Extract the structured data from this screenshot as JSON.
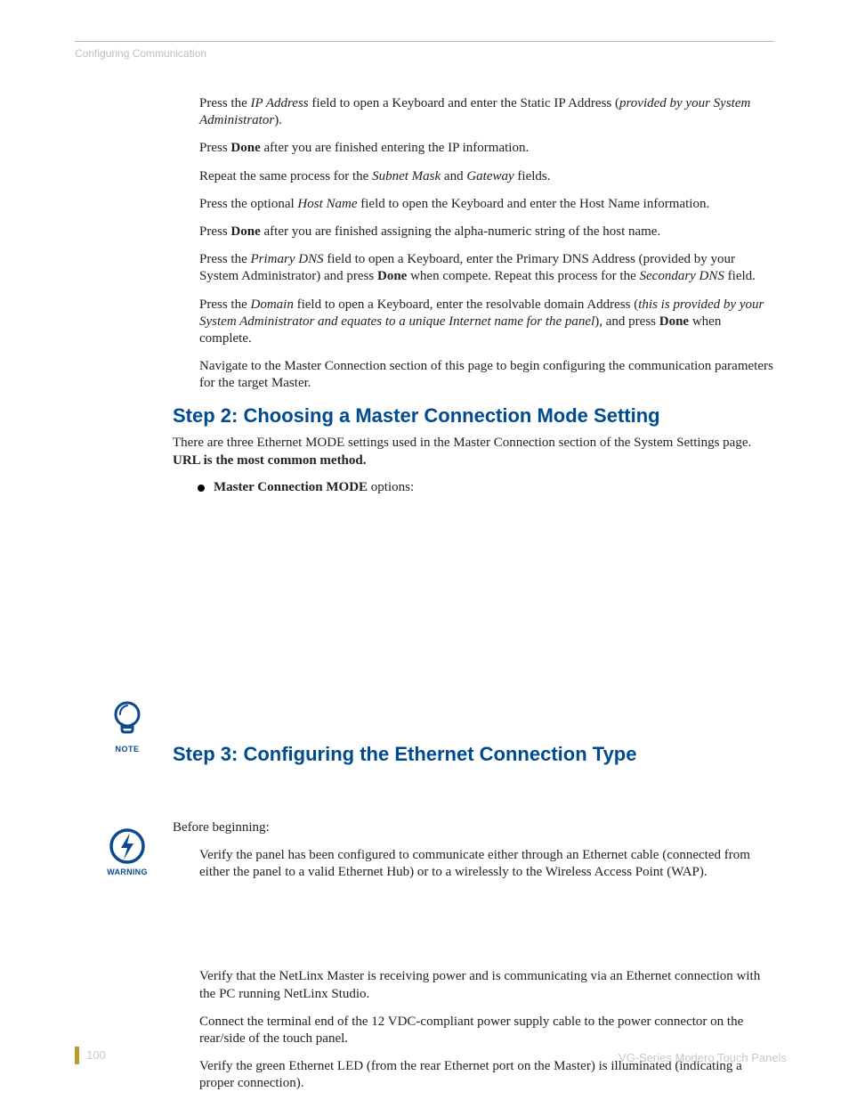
{
  "running_head": "Configuring Communication",
  "paragraphs": {
    "p1_a": "Press the ",
    "p1_field": "IP Address",
    "p1_b": " field to open a Keyboard and enter the Static IP Address (",
    "p1_c": "provided by your System Administrator",
    "p1_d": ").",
    "p2_a": "Press ",
    "p2_b": "Done",
    "p2_c": " after you are finished entering the IP information.",
    "p3_a": "Repeat the same process for the ",
    "p3_b": "Subnet Mask",
    "p3_c": " and ",
    "p3_d": "Gateway",
    "p3_e": " fields.",
    "p4_a": "Press the optional ",
    "p4_b": "Host Name",
    "p4_c": " field to open the Keyboard and enter the Host Name information.",
    "p5_a": "Press ",
    "p5_b": "Done",
    "p5_c": " after you are finished assigning the alpha-numeric string of the host name.",
    "p6_a": "Press the ",
    "p6_b": "Primary DNS",
    "p6_c": " field to open a Keyboard, enter the Primary DNS Address (provided by your System Administrator) and press ",
    "p6_d": "Done",
    "p6_e": " when compete. Repeat this process for the ",
    "p6_f": "Secondary DNS",
    "p6_g": " field.",
    "p7_a": "Press the ",
    "p7_b": "Domain",
    "p7_c": " field to open a Keyboard, enter the resolvable domain Address (",
    "p7_d": "this is provided by your System Administrator and equates to a unique Internet name for the panel",
    "p7_e": "), and press ",
    "p7_f": "Done",
    "p7_g": " when complete.",
    "p8": "Navigate to the Master Connection section of this page to begin configuring the communication parameters for the target Master."
  },
  "step2": {
    "heading": "Step 2: Choosing a Master Connection Mode Setting",
    "intro_a": "There are three Ethernet MODE settings used in the Master Connection section of the System Settings page. ",
    "intro_b": "URL is the most common method.",
    "bullet_a": "Master Connection MODE",
    "bullet_b": " options:"
  },
  "step3": {
    "heading": "Step 3: Configuring the Ethernet Connection Type",
    "before": "Before beginning:",
    "v1": "Verify the panel has been configured to communicate either through an Ethernet cable (connected from either the panel to a valid Ethernet Hub) or to a wirelessly to the Wireless Access Point (WAP).",
    "v2": "Verify that the NetLinx Master is receiving power and is communicating via an Ethernet connection with the PC running NetLinx Studio.",
    "v3": "Connect the terminal end of the 12 VDC-compliant power supply cable to the power connector on the rear/side of the touch panel.",
    "v4": "Verify the green Ethernet LED (from the rear Ethernet port on the Master) is illuminated (indicating a proper connection)."
  },
  "icons": {
    "note_caption": "NOTE",
    "warning_caption": "WARNING"
  },
  "footer": {
    "page_number": "100",
    "doc_title": "VG-Series Modero Touch Panels"
  }
}
